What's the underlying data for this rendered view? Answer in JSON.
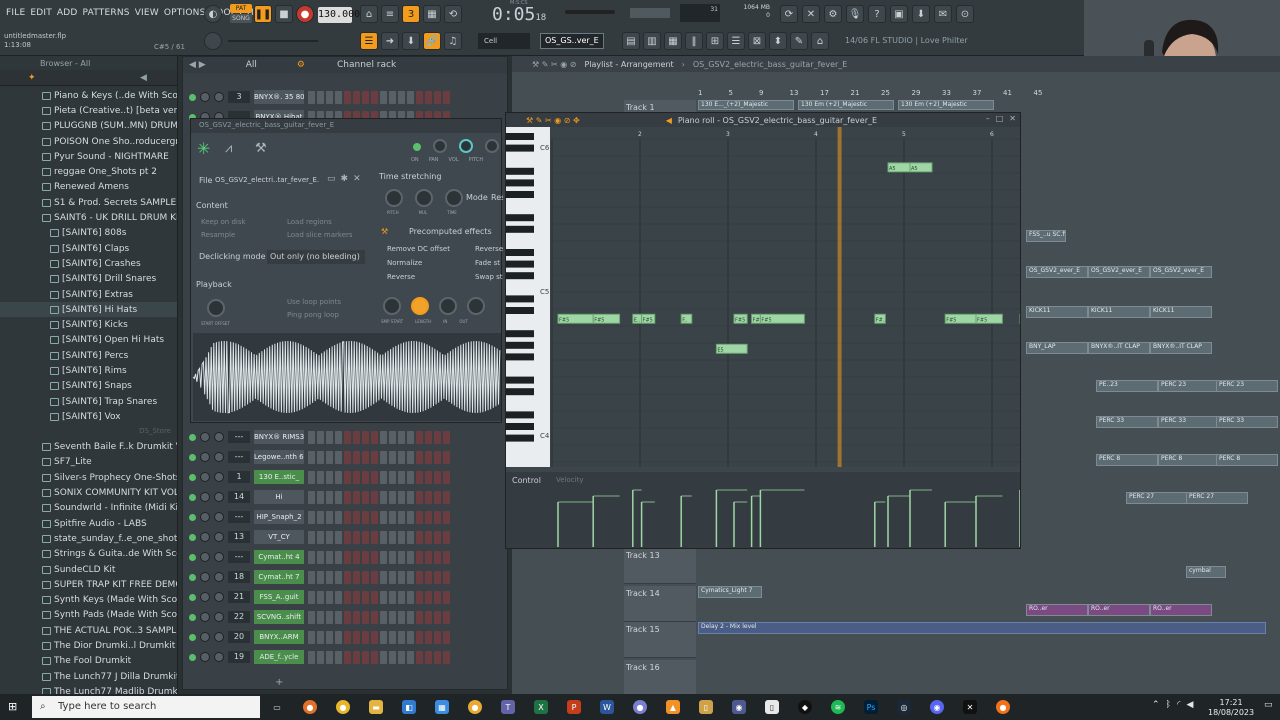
{
  "menu": [
    "FILE",
    "EDIT",
    "ADD",
    "PATTERNS",
    "VIEW",
    "OPTIONS",
    "TOOLS",
    "HELP"
  ],
  "topbar": {
    "pat_label": "PAT",
    "song_label": "SONG",
    "tempo": "130.000",
    "time": "0:05",
    "time_frac": "18",
    "time_label": "M:S:CS",
    "cpu": "31",
    "mem": "1064 MB",
    "mem2": "0",
    "file_name": "untitledmaster.flp",
    "file_pos": "1:13:08",
    "file_extra": "C#5 / 61",
    "snap": "Cell",
    "pattern_name": "OS_GS..ver_E",
    "hint": "14/06  FL STUDIO | Love Philter"
  },
  "browser": {
    "title": "Browser - All",
    "items": [
      "Piano & Keys (..de With Scorch)",
      "Pieta (Creative..t) [beta version]",
      "PLUGGNB (SUM..MN) DRUMKIT",
      "POISON One Sho..roducergrind)",
      "Pyur Sound - NIGHTMARE",
      "reggae One_Shots pt 2",
      "Renewed Amens",
      "S1 & Prod. Secrets SAMPLE PACK",
      "SAINT6 - UK DRILL DRUM KIT",
      "[SAINT6] 808s",
      "[SAINT6] Claps",
      "[SAINT6] Crashes",
      "[SAINT6] Drill Snares",
      "[SAINT6] Extras",
      "[SAINT6] Hi Hats",
      "[SAINT6] Kicks",
      "[SAINT6] Open Hi Hats",
      "[SAINT6] Percs",
      "[SAINT6] Rims",
      "[SAINT6] Snaps",
      "[SAINT6] Trap Snares",
      "[SAINT6] Vox"
    ],
    "lower_tag": "DS_Store",
    "items2": [
      "Seventh Baile F..k Drumkit Vol.2",
      "SF7_Lite",
      "Silver-s Prophecy One-Shots",
      "SONIX COMMUNITY KIT VOL 2",
      "Soundwrld - Infinite (Midi Kit)",
      "Spitfire Audio - LABS",
      "state_sunday_f..e_one_shot_kit",
      "Strings & Guita..de With Scorch)",
      "SundeCLD Kit",
      "SUPER TRAP KIT FREE DEMO",
      "Synth Keys (Made With Scorch)",
      "Synth Pads (Made With Scorch)",
      "THE ACTUAL POK..3 SAMPLE KIT",
      "The Dior Drumki..l Drumkit Vol.2",
      "The Fool Drumkit",
      "The Lunch77 J Dilla Drumkit",
      "The Lunch77 Madlib Drumkit"
    ]
  },
  "rack": {
    "title": "Channel rack",
    "filter": "All",
    "top_rows": [
      {
        "num": "3",
        "name": "BNYX®. 35 808"
      },
      {
        "num": "",
        "name": "BNYX®.Hihat"
      }
    ],
    "rows": [
      {
        "num": "---",
        "name": "BNYX® RIMS3"
      },
      {
        "num": "---",
        "name": "Legowe..nth 63"
      },
      {
        "num": "1",
        "name": "130 E..stic_"
      },
      {
        "num": "14",
        "name": "Hi"
      },
      {
        "num": "---",
        "name": "HIP_Snaph_2"
      },
      {
        "num": "13",
        "name": "VT_CY"
      },
      {
        "num": "---",
        "name": "Cymat..ht 4"
      },
      {
        "num": "18",
        "name": "Cymat..ht 7"
      },
      {
        "num": "21",
        "name": "FSS_A..guit"
      },
      {
        "num": "22",
        "name": "SCVNG..shift"
      },
      {
        "num": "20",
        "name": "BNYX..ARM"
      },
      {
        "num": "19",
        "name": "ADE_f..ycle"
      }
    ]
  },
  "sampler": {
    "title": "OS_GSV2_electric_bass_guitar_fever_E",
    "file_label": "File",
    "file_name": "OS_GSV2_electri..tar_fever_E.wav",
    "content_label": "Content",
    "keep_on_disk": "Keep on disk",
    "load_regions": "Load regions",
    "resample": "Resample",
    "load_slice": "Load slice markers",
    "declicking_label": "Declicking mode",
    "declicking_value": "Out only (no bleeding)",
    "playback_label": "Playback",
    "use_loop": "Use loop points",
    "ping_pong": "Ping pong loop",
    "smp_start": "START OFFSET",
    "time_stretching": "Time stretching",
    "mode": "Mode",
    "res": "Res",
    "pitch": "PITCH",
    "mul": "MUL",
    "time": "TIME",
    "precomputed": "Precomputed effects",
    "remove_dc": "Remove DC offset",
    "reverse_polarity": "Reverse",
    "normalize": "Normalize",
    "fade_st": "Fade st",
    "reverse": "Reverse",
    "swap": "Swap st",
    "knobs": [
      "SMP START",
      "LENGTH",
      "IN",
      "OUT"
    ],
    "top_knobs": [
      "ON",
      "PAN",
      "VOL",
      "PITCH"
    ]
  },
  "playlist": {
    "title": "Playlist - Arrangement",
    "pattern": "OS_GSV2_electric_bass_guitar_fever_E",
    "tracks": [
      "Track 1",
      "Track 13",
      "Track 14",
      "Track 15",
      "Track 16"
    ],
    "ruler": [
      "1",
      "5",
      "9",
      "13",
      "17",
      "21",
      "25",
      "29",
      "33",
      "37",
      "41",
      "45"
    ],
    "track1_clips": [
      "130 E..._(+2)_Majestic",
      "130 Em (+2)_Majestic",
      "130 Em (+2)_Majestic"
    ],
    "clip_cymatics": "Cymatics_Light 7",
    "clip_delay": "Delay 2 - Mix level",
    "right_clips": [
      "FSS_..u SC.ft",
      "OS_GSV2_ever_E",
      "OS_GSV2_ever_E",
      "OS_GSV2_ever_E",
      "KICK11",
      "KICK11",
      "KICK11",
      "BNY_LAP",
      "BNYX®..IT CLAP",
      "BNYX®..IT CLAP",
      "PE..23",
      "PERC 23",
      "PERC 23",
      "PERC 33",
      "PERC 33",
      "PERC 33",
      "PERC 8",
      "PERC 8",
      "PERC 8",
      "PERC 27",
      "PERC 27",
      "cymbal",
      "RO..er",
      "RO..er",
      "RO..er"
    ]
  },
  "pianoroll": {
    "title": "Piano roll - OS_GSV2_electric_bass_guitar_fever_E",
    "control_label": "Control",
    "velocity_label": "Velocity",
    "bars": [
      "2",
      "3",
      "4",
      "5",
      "6"
    ],
    "octaves": [
      "C6",
      "C5",
      "C4"
    ],
    "notes": [
      {
        "label": "F#5",
        "row": "F#5",
        "start": 1.0,
        "len": 0.4
      },
      {
        "label": "F#5",
        "row": "F#5",
        "start": 1.4,
        "len": 0.3
      },
      {
        "label": "E..",
        "row": "F#5",
        "start": 1.85,
        "len": 0.1
      },
      {
        "label": "F#5",
        "row": "F#5",
        "start": 1.95,
        "len": 0.15
      },
      {
        "label": "F..",
        "row": "F#5",
        "start": 2.4,
        "len": 0.12
      },
      {
        "label": "E5",
        "row": "E5",
        "start": 2.8,
        "len": 0.35
      },
      {
        "label": "F#5",
        "row": "F#5",
        "start": 3.0,
        "len": 0.15
      },
      {
        "label": "F#5",
        "row": "F#5",
        "start": 3.2,
        "len": 0.1
      },
      {
        "label": "F#5",
        "row": "F#5",
        "start": 3.3,
        "len": 0.5
      },
      {
        "label": "F#..",
        "row": "F#5",
        "start": 4.6,
        "len": 0.12
      },
      {
        "label": "A5",
        "row": "A5",
        "start": 4.75,
        "len": 0.25
      },
      {
        "label": "A5",
        "row": "A5",
        "start": 5.0,
        "len": 0.25
      },
      {
        "label": "F#5",
        "row": "F#5",
        "start": 5.4,
        "len": 0.35
      },
      {
        "label": "F#5",
        "row": "F#5",
        "start": 5.75,
        "len": 0.3
      },
      {
        "label": "F#5",
        "row": "F#5",
        "start": 6.25,
        "len": 0.25
      }
    ],
    "playhead_bar": 4.2
  },
  "taskbar": {
    "search_placeholder": "Type here to search",
    "time": "17:21",
    "date": "18/08/2023"
  },
  "colors": {
    "accent": "#f29b1d",
    "note": "#9fd6a5",
    "rack_step": "#6b3d40"
  }
}
